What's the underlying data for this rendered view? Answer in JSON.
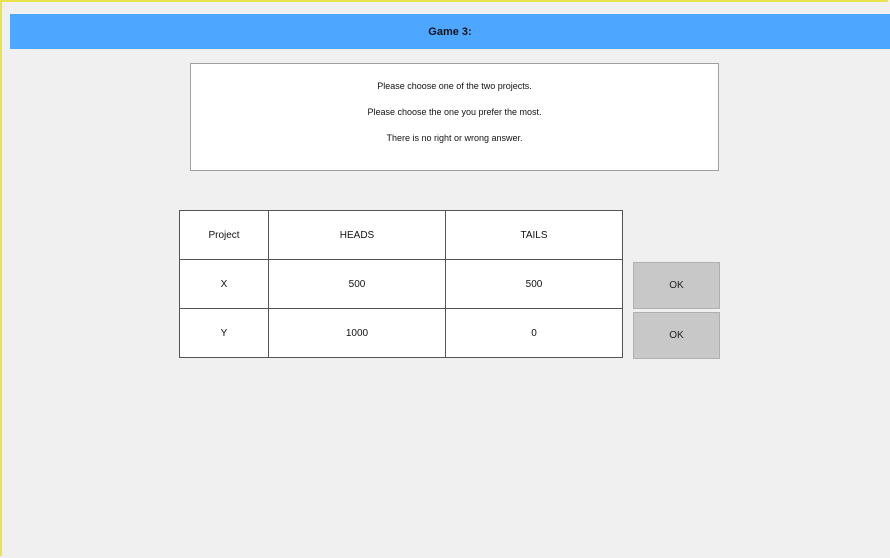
{
  "header": {
    "title": "Game 3:"
  },
  "instructions": {
    "line1": "Please choose one of the two projects.",
    "line2": "Please choose the one you prefer the most.",
    "line3": "There is no right or wrong answer."
  },
  "table": {
    "headers": [
      "Project",
      "HEADS",
      "TAILS"
    ],
    "rows": [
      {
        "project": "X",
        "heads": "500",
        "tails": "500",
        "button": "OK"
      },
      {
        "project": "Y",
        "heads": "1000",
        "tails": "0",
        "button": "OK"
      }
    ]
  },
  "colors": {
    "header_bg": "#4da6ff",
    "button_bg": "#c8c8c8",
    "frame": "#e8e34a"
  }
}
